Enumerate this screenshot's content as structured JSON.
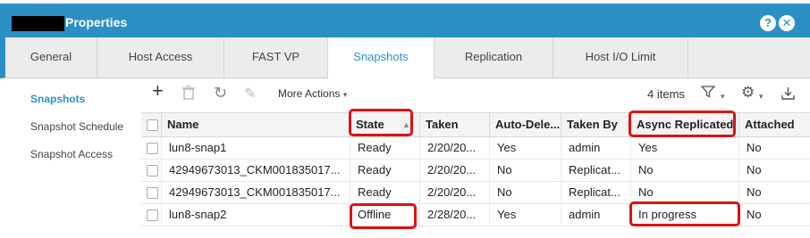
{
  "window": {
    "title": "Properties"
  },
  "tabs": [
    {
      "label": "General"
    },
    {
      "label": "Host Access"
    },
    {
      "label": "FAST VP"
    },
    {
      "label": "Snapshots"
    },
    {
      "label": "Replication"
    },
    {
      "label": "Host I/O Limit"
    }
  ],
  "sidebar": {
    "items": [
      {
        "label": "Snapshots"
      },
      {
        "label": "Snapshot Schedule"
      },
      {
        "label": "Snapshot Access"
      }
    ]
  },
  "toolbar": {
    "more_actions_label": "More Actions",
    "item_count": "4 items"
  },
  "grid": {
    "columns": [
      "Name",
      "State",
      "Taken",
      "Auto-Dele...",
      "Taken By",
      "Async Replicated",
      "Attached"
    ],
    "rows": [
      {
        "name": "lun8-snap1",
        "state": "Ready",
        "taken": "2/20/20...",
        "auto_delete": "Yes",
        "taken_by": "admin",
        "async_replicated": "Yes",
        "attached": "No"
      },
      {
        "name": "42949673013_CKM001835017...",
        "state": "Ready",
        "taken": "2/20/20...",
        "auto_delete": "No",
        "taken_by": "Replicat...",
        "async_replicated": "No",
        "attached": "No"
      },
      {
        "name": "42949673013_CKM001835017...",
        "state": "Ready",
        "taken": "2/20/20...",
        "auto_delete": "No",
        "taken_by": "Replicat...",
        "async_replicated": "No",
        "attached": "No"
      },
      {
        "name": "lun8-snap2",
        "state": "Offline",
        "taken": "2/28/20...",
        "auto_delete": "Yes",
        "taken_by": "admin",
        "async_replicated": "In progress",
        "attached": "No"
      }
    ]
  },
  "colors": {
    "accent": "#2c8fc4",
    "highlight": "#e01010"
  }
}
